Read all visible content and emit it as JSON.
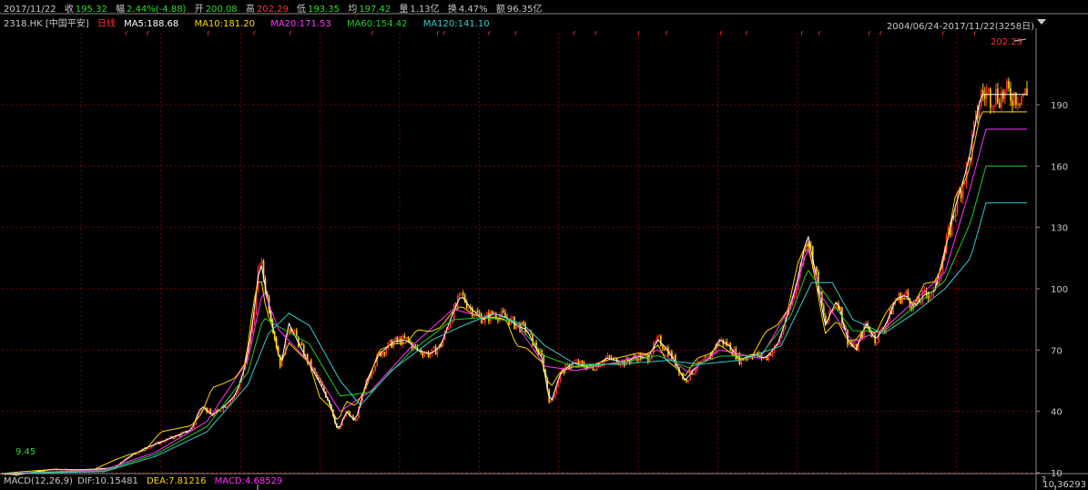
{
  "info": {
    "date": "2017/11/22",
    "close_label": "收",
    "close": "195.32",
    "change_label": "幅",
    "change": "2.44%(-4.88)",
    "open_label": "开",
    "open": "200.08",
    "high_label": "高",
    "high": "202.29",
    "low_label": "低",
    "low": "193.35",
    "avg_label": "均",
    "avg": "197.42",
    "vol_label": "量",
    "vol": "1.13亿",
    "turnover_label": "换",
    "turnover": "4.47%",
    "amount_label": "额",
    "amount": "96.35亿"
  },
  "ma_bar": {
    "ticker": "2318.HK [中国平安]",
    "period": "日线",
    "ma5": "MA5:188.68",
    "ma10": "MA10:181.20",
    "ma20": "MA20:171.53",
    "ma60": "MA60:154.42",
    "ma120": "MA120:141.10"
  },
  "range_label": "2004/06/24-2017/11/22(3258日)",
  "macd_bar": {
    "name": "MACD(12,26,9)",
    "dif": "DIF:10.15481",
    "dea": "DEA:7.81216",
    "macd": "MACD:4.68529"
  },
  "macd_help": "?",
  "macd_value": "10.36293",
  "marker_glyph": "r",
  "colors": {
    "background": "#000000",
    "up": "#ff3232",
    "down": "#ffd200",
    "ma5": "#ffffff",
    "ma10": "#ffd800",
    "ma20": "#ff33ff",
    "ma60": "#22cc22",
    "ma120": "#33cccc",
    "grid": "#7a0000",
    "green_text": "#2fd92f",
    "red_text": "#ff3232",
    "label_text": "#c8c8c8"
  },
  "chart_data": {
    "type": "candlestick",
    "title": "",
    "x_range": [
      "2004/06/24",
      "2017/11/22"
    ],
    "y_ticks": [
      10,
      40,
      70,
      100,
      130,
      160,
      190
    ],
    "ylim": [
      4,
      205
    ],
    "grid": true,
    "annotations": {
      "max_label": "202.29",
      "min_label": "9.45"
    },
    "marker_positions": [
      0.12,
      0.141,
      0.2,
      0.245,
      0.28,
      0.36,
      0.424,
      0.43,
      0.474,
      0.5,
      0.557,
      0.578,
      0.62,
      0.647,
      0.7,
      0.725,
      0.779,
      0.796,
      0.845,
      0.856,
      0.917,
      0.948
    ],
    "close_series": [
      [
        0.0,
        9.5
      ],
      [
        0.015,
        9.1
      ],
      [
        0.03,
        10.2
      ],
      [
        0.05,
        11.7
      ],
      [
        0.07,
        11.4
      ],
      [
        0.09,
        11.7
      ],
      [
        0.11,
        12.4
      ],
      [
        0.125,
        18
      ],
      [
        0.14,
        22
      ],
      [
        0.155,
        25
      ],
      [
        0.17,
        28
      ],
      [
        0.185,
        31
      ],
      [
        0.195,
        43
      ],
      [
        0.205,
        38
      ],
      [
        0.218,
        43
      ],
      [
        0.228,
        48
      ],
      [
        0.238,
        63
      ],
      [
        0.245,
        84
      ],
      [
        0.252,
        115
      ],
      [
        0.258,
        98
      ],
      [
        0.265,
        80
      ],
      [
        0.272,
        62
      ],
      [
        0.28,
        83
      ],
      [
        0.29,
        73
      ],
      [
        0.3,
        63
      ],
      [
        0.31,
        54
      ],
      [
        0.32,
        44
      ],
      [
        0.328,
        30
      ],
      [
        0.336,
        40
      ],
      [
        0.345,
        35
      ],
      [
        0.356,
        55
      ],
      [
        0.368,
        68
      ],
      [
        0.382,
        74
      ],
      [
        0.395,
        75
      ],
      [
        0.405,
        70
      ],
      [
        0.418,
        68
      ],
      [
        0.428,
        72
      ],
      [
        0.44,
        88
      ],
      [
        0.448,
        97
      ],
      [
        0.458,
        90
      ],
      [
        0.47,
        85
      ],
      [
        0.48,
        88
      ],
      [
        0.492,
        86
      ],
      [
        0.502,
        82
      ],
      [
        0.512,
        80
      ],
      [
        0.52,
        72
      ],
      [
        0.527,
        66
      ],
      [
        0.535,
        43
      ],
      [
        0.545,
        59
      ],
      [
        0.558,
        64
      ],
      [
        0.575,
        61
      ],
      [
        0.59,
        66
      ],
      [
        0.608,
        64
      ],
      [
        0.62,
        67
      ],
      [
        0.63,
        66
      ],
      [
        0.64,
        75
      ],
      [
        0.648,
        71
      ],
      [
        0.656,
        65
      ],
      [
        0.666,
        55
      ],
      [
        0.678,
        62
      ],
      [
        0.69,
        66
      ],
      [
        0.7,
        75
      ],
      [
        0.71,
        72
      ],
      [
        0.72,
        65
      ],
      [
        0.732,
        68
      ],
      [
        0.745,
        66
      ],
      [
        0.757,
        73
      ],
      [
        0.767,
        88
      ],
      [
        0.776,
        104
      ],
      [
        0.786,
        127
      ],
      [
        0.795,
        105
      ],
      [
        0.803,
        82
      ],
      [
        0.815,
        95
      ],
      [
        0.825,
        75
      ],
      [
        0.833,
        70
      ],
      [
        0.843,
        83
      ],
      [
        0.852,
        75
      ],
      [
        0.862,
        82
      ],
      [
        0.872,
        95
      ],
      [
        0.882,
        97
      ],
      [
        0.89,
        91
      ],
      [
        0.9,
        97
      ],
      [
        0.91,
        99
      ],
      [
        0.918,
        115
      ],
      [
        0.93,
        140
      ],
      [
        0.942,
        160
      ],
      [
        0.955,
        195
      ]
    ],
    "ma120_series": [
      [
        0.0,
        9.6
      ],
      [
        0.1,
        10.5
      ],
      [
        0.15,
        18
      ],
      [
        0.2,
        30
      ],
      [
        0.24,
        53
      ],
      [
        0.26,
        78
      ],
      [
        0.28,
        88
      ],
      [
        0.3,
        82
      ],
      [
        0.33,
        55
      ],
      [
        0.35,
        43
      ],
      [
        0.38,
        60
      ],
      [
        0.42,
        75
      ],
      [
        0.45,
        82
      ],
      [
        0.48,
        88
      ],
      [
        0.51,
        82
      ],
      [
        0.53,
        72
      ],
      [
        0.56,
        63
      ],
      [
        0.6,
        63
      ],
      [
        0.65,
        65
      ],
      [
        0.68,
        63
      ],
      [
        0.72,
        65
      ],
      [
        0.76,
        72
      ],
      [
        0.79,
        103
      ],
      [
        0.81,
        103
      ],
      [
        0.83,
        85
      ],
      [
        0.86,
        78
      ],
      [
        0.89,
        88
      ],
      [
        0.92,
        100
      ],
      [
        0.945,
        115
      ],
      [
        0.96,
        142
      ]
    ],
    "ma20_series": [
      [
        0.0,
        9.5
      ],
      [
        0.1,
        11.5
      ],
      [
        0.15,
        20
      ],
      [
        0.2,
        35
      ],
      [
        0.24,
        65
      ],
      [
        0.255,
        100
      ],
      [
        0.27,
        80
      ],
      [
        0.3,
        64
      ],
      [
        0.33,
        40
      ],
      [
        0.36,
        50
      ],
      [
        0.4,
        72
      ],
      [
        0.44,
        90
      ],
      [
        0.47,
        86
      ],
      [
        0.5,
        84
      ],
      [
        0.53,
        62
      ],
      [
        0.56,
        60
      ],
      [
        0.6,
        64
      ],
      [
        0.64,
        70
      ],
      [
        0.67,
        59
      ],
      [
        0.7,
        70
      ],
      [
        0.74,
        66
      ],
      [
        0.77,
        92
      ],
      [
        0.786,
        120
      ],
      [
        0.8,
        96
      ],
      [
        0.83,
        74
      ],
      [
        0.86,
        80
      ],
      [
        0.89,
        94
      ],
      [
        0.92,
        108
      ],
      [
        0.945,
        150
      ],
      [
        0.96,
        178
      ]
    ]
  }
}
